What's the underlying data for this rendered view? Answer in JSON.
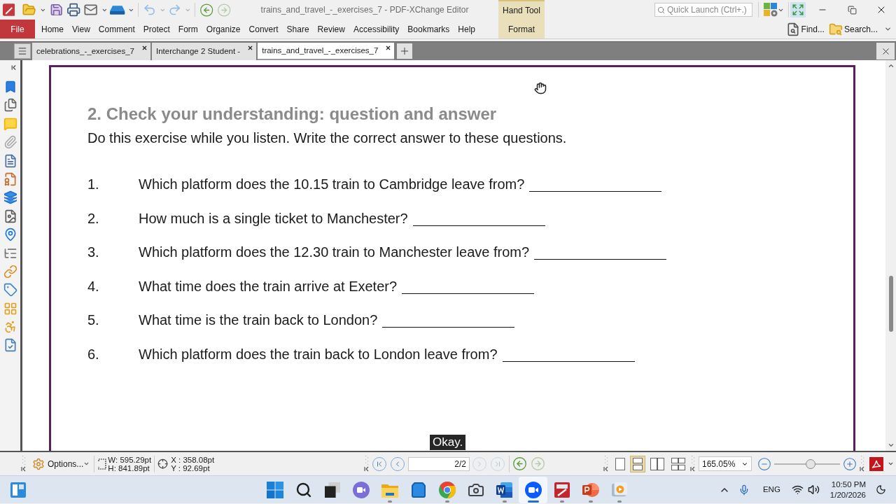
{
  "window": {
    "title": "trains_and_travel_-_exercises_7 - PDF-XChange Editor",
    "quick_launch": {
      "placeholder": "Quick Launch (Ctrl+.)"
    }
  },
  "ribbon": {
    "file": "File",
    "tabs": [
      "Home",
      "View",
      "Comment",
      "Protect",
      "Form",
      "Organize",
      "Convert",
      "Share",
      "Review",
      "Accessibility",
      "Bookmarks",
      "Help"
    ],
    "context_group": {
      "title": "Hand Tool",
      "tabs": [
        "Format"
      ]
    },
    "actions": [
      "Find...",
      "Search..."
    ]
  },
  "document_tabs": [
    {
      "label": "celebrations_-_exercises_7",
      "selected": false
    },
    {
      "label": "Interchange 2 Student -",
      "selected": false
    },
    {
      "label": "trains_and_travel_-_exercises_7",
      "selected": true
    }
  ],
  "page": {
    "heading": "2. Check your understanding: question and answer",
    "instruction": "Do this exercise while you listen. Write the correct answer to these questions.",
    "questions": [
      {
        "number": "1.",
        "text": "Which platform does the 10.15 train to Cambridge leave from?"
      },
      {
        "number": "2.",
        "text": "How much is a single ticket to Manchester?"
      },
      {
        "number": "3.",
        "text": "Which platform does the 12.30 train to Manchester leave from?"
      },
      {
        "number": "4.",
        "text": "What time does the train arrive at Exeter?"
      },
      {
        "number": "5.",
        "text": "What time is the train back to London?"
      },
      {
        "number": "6.",
        "text": "Which platform does the train back to London leave from?"
      }
    ]
  },
  "caption": "Okay.",
  "status_bar": {
    "options": "Options...",
    "size": [
      "W: 595.29pt",
      "H: 841.89pt"
    ],
    "cursor": [
      "X : 358.08pt",
      "Y : 92.69pt"
    ],
    "page": "2/2",
    "view_modes": [
      {
        "selected": false
      },
      {
        "selected": true
      },
      {
        "selected": false
      },
      {
        "selected": false
      }
    ],
    "zoom": "165.05%",
    "zoom_slider": {
      "level": 0.55
    }
  },
  "taskbar": {
    "apps": [
      {
        "kind": "start",
        "running": false,
        "selected": false
      },
      {
        "kind": "search",
        "running": false,
        "selected": false
      },
      {
        "kind": "taskview",
        "running": false,
        "selected": false
      },
      {
        "kind": "meet",
        "running": false,
        "selected": false
      },
      {
        "kind": "files",
        "running": true,
        "selected": false
      },
      {
        "kind": "store",
        "running": false,
        "selected": false
      },
      {
        "kind": "browser",
        "running": true,
        "selected": false
      },
      {
        "kind": "camera",
        "running": false,
        "selected": false
      },
      {
        "kind": "word",
        "running": true,
        "selected": false
      },
      {
        "kind": "zoom",
        "running": true,
        "selected": true
      },
      {
        "kind": "pdf",
        "running": true,
        "selected": false
      },
      {
        "kind": "slides",
        "running": true,
        "selected": false
      },
      {
        "kind": "player",
        "running": true,
        "selected": false
      }
    ],
    "language": "ENG",
    "time": "10:50 PM",
    "date": "1/20/2026"
  }
}
